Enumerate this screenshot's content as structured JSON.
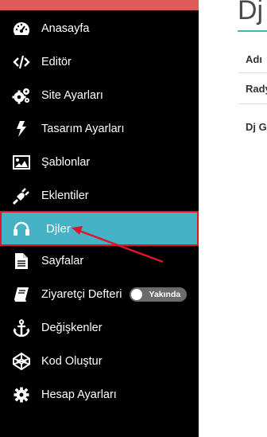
{
  "sidebar": {
    "items": [
      {
        "label": "Anasayfa",
        "icon": "dashboard-icon"
      },
      {
        "label": "Editör",
        "icon": "code-icon"
      },
      {
        "label": "Site Ayarları",
        "icon": "cogs-icon"
      },
      {
        "label": "Tasarım Ayarları",
        "icon": "bolt-icon"
      },
      {
        "label": "Şablonlar",
        "icon": "image-icon"
      },
      {
        "label": "Eklentiler",
        "icon": "plug-icon"
      },
      {
        "label": "Djler",
        "icon": "headphones-icon",
        "active": true
      },
      {
        "label": "Sayfalar",
        "icon": "file-icon"
      },
      {
        "label": "Ziyaretçi Defteri",
        "icon": "book-icon",
        "badge": "Yakında"
      },
      {
        "label": "Değişkenler",
        "icon": "anchor-icon"
      },
      {
        "label": "Kod Oluştur",
        "icon": "codepen-icon"
      },
      {
        "label": "Hesap Ayarları",
        "icon": "gear-icon"
      }
    ]
  },
  "main": {
    "title": "Dj",
    "table": {
      "header": "Adı",
      "rows": [
        "Rady",
        "Dj G"
      ]
    }
  },
  "colors": {
    "topbar": "#e05a57",
    "active": "#45b2c6",
    "highlight_border": "#e0142b",
    "annotation_arrow": "#e0142b"
  }
}
